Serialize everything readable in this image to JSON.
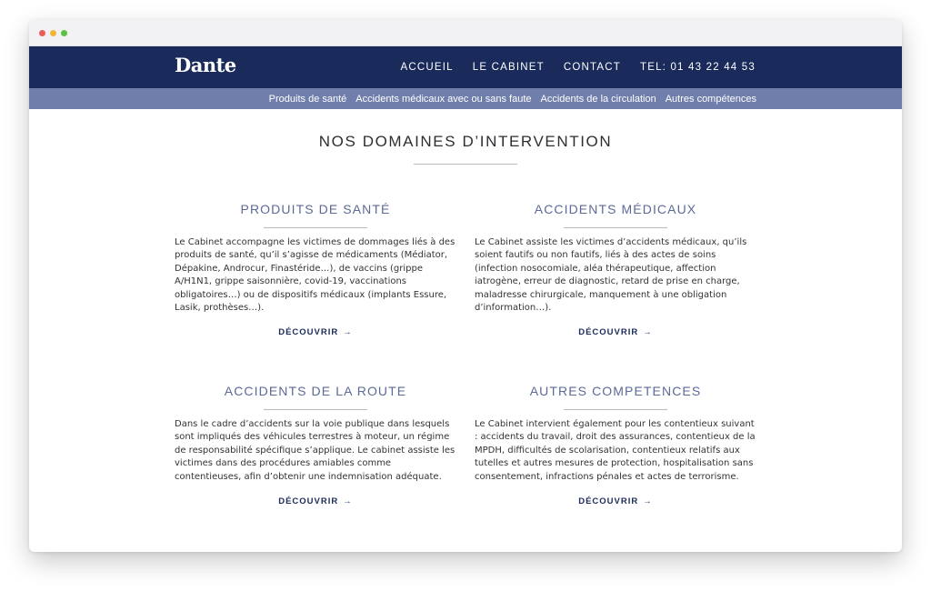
{
  "site": {
    "logo": "Dante",
    "menu": [
      "ACCUEIL",
      "LE CABINET",
      "CONTACT",
      "TEL: 01 43 22 44 53"
    ]
  },
  "subnav": [
    "Produits de santé",
    "Accidents médicaux avec ou sans faute",
    "Accidents de la circulation",
    "Autres compétences"
  ],
  "main": {
    "title": "NOS DOMAINES D’INTERVENTION",
    "cards": [
      {
        "title": "PRODUITS DE SANTÉ",
        "text": "Le Cabinet accompagne les victimes de dommages liés à des produits de santé, qu’il s’agisse de médicaments (Médiator, Dépakine, Androcur, Finastéride…), de vaccins (grippe A/H1N1, grippe saisonnière, covid-19, vaccinations obligatoires…) ou de dispositifs médicaux (implants Essure, Lasik, prothèses…).",
        "cta": "DÉCOUVRIR"
      },
      {
        "title": "ACCIDENTS MÉDICAUX",
        "text": "Le Cabinet assiste les victimes d’accidents médicaux, qu’ils soient fautifs ou non fautifs, liés à des actes de soins (infection nosocomiale, aléa thérapeutique, affection iatrogène, erreur de diagnostic, retard de prise en charge, maladresse chirurgicale, manquement à une obligation d’information…).",
        "cta": "DÉCOUVRIR"
      },
      {
        "title": "ACCIDENTS DE LA ROUTE",
        "text": "Dans le cadre d’accidents sur la voie publique dans lesquels sont impliqués des véhicules terrestres à moteur, un régime de responsabilité spécifique s’applique. Le cabinet assiste les victimes dans des procédures amiables comme contentieuses, afin d’obtenir une indemnisation adéquate.",
        "cta": "DÉCOUVRIR"
      },
      {
        "title": "AUTRES COMPETENCES",
        "text": "Le Cabinet intervient également pour les contentieux suivant : accidents du travail, droit des assurances, contentieux de la MPDH, difficultés de scolarisation, contentieux relatifs aux tutelles et autres mesures de protection, hospitalisation sans consentement, infractions pénales et actes de terrorisme.",
        "cta": "DÉCOUVRIR"
      }
    ]
  },
  "icons": {
    "cta_arrow": "arrow-right-icon"
  },
  "colors": {
    "nav_bg": "#1a2b5b",
    "subnav_bg": "#6f7eab",
    "card_title": "#5c6a98"
  }
}
